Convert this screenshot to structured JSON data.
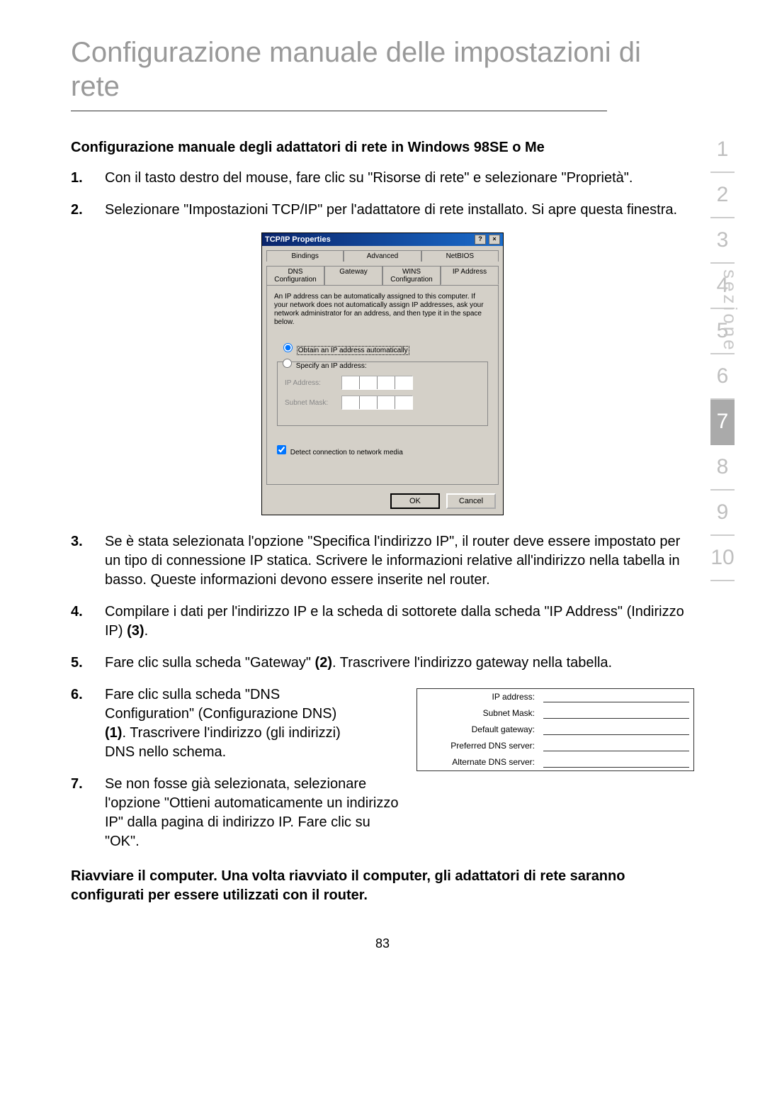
{
  "title": "Configurazione manuale delle impostazioni di rete",
  "subheading": "Configurazione manuale degli adattatori di rete in Windows 98SE o Me",
  "steps": {
    "s1": {
      "num": "1.",
      "text": "Con il tasto destro del mouse, fare clic su \"Risorse di rete\" e selezionare \"Proprietà\"."
    },
    "s2": {
      "num": "2.",
      "text": "Selezionare \"Impostazioni TCP/IP\" per l'adattatore di rete installato. Si apre questa finestra."
    },
    "s3": {
      "num": "3.",
      "text": "Se è stata selezionata l'opzione \"Specifica l'indirizzo IP\", il router deve essere impostato per un tipo di connessione IP statica. Scrivere le informazioni relative all'indirizzo nella tabella in basso. Queste informazioni devono essere inserite nel router."
    },
    "s4": {
      "num": "4.",
      "text_a": "Compilare i dati per l'indirizzo IP e la scheda di sottorete dalla scheda \"IP Address\" (Indirizzo IP) ",
      "text_b": "(3)",
      "text_c": "."
    },
    "s5": {
      "num": "5.",
      "text_a": "Fare clic sulla scheda \"Gateway\" ",
      "text_b": "(2)",
      "text_c": ". Trascrivere l'indirizzo gateway nella tabella."
    },
    "s6": {
      "num": "6.",
      "text_a": "Fare clic sulla scheda \"DNS Configuration\" (Configurazione DNS) ",
      "text_b": "(1)",
      "text_c": ". Trascrivere l'indirizzo (gli indirizzi) DNS nello schema."
    },
    "s7": {
      "num": "7.",
      "text": "Se non fosse già selezionata, selezionare l'opzione \"Ottieni automaticamente un indirizzo IP\" dalla pagina di indirizzo IP. Fare clic su \"OK\"."
    }
  },
  "footer_bold": "Riavviare il computer. Una volta riavviato il computer, gli adattatori di rete saranno configurati per essere utilizzati con il router.",
  "page_number": "83",
  "dialog": {
    "title": "TCP/IP Properties",
    "tabs_row1": {
      "t1": "Bindings",
      "t2": "Advanced",
      "t3": "NetBIOS"
    },
    "tabs_row2": {
      "t1": "DNS Configuration",
      "t2": "Gateway",
      "t3": "WINS Configuration",
      "t4": "IP Address"
    },
    "desc": "An IP address can be automatically assigned to this computer. If your network does not automatically assign IP addresses, ask your network administrator for an address, and then type it in the space below.",
    "radio_auto": "Obtain an IP address automatically",
    "radio_specify": "Specify an IP address:",
    "ip_label": "IP Address:",
    "mask_label": "Subnet Mask:",
    "detect": "Detect connection to network media",
    "ok": "OK",
    "cancel": "Cancel"
  },
  "note_table": {
    "r1": "IP address:",
    "r2": "Subnet Mask:",
    "r3": "Default gateway:",
    "r4": "Preferred DNS server:",
    "r5": "Alternate DNS server:"
  },
  "nav": {
    "label": "sezione",
    "items": [
      "1",
      "2",
      "3",
      "4",
      "5",
      "6",
      "7",
      "8",
      "9",
      "10"
    ],
    "active": "7"
  }
}
